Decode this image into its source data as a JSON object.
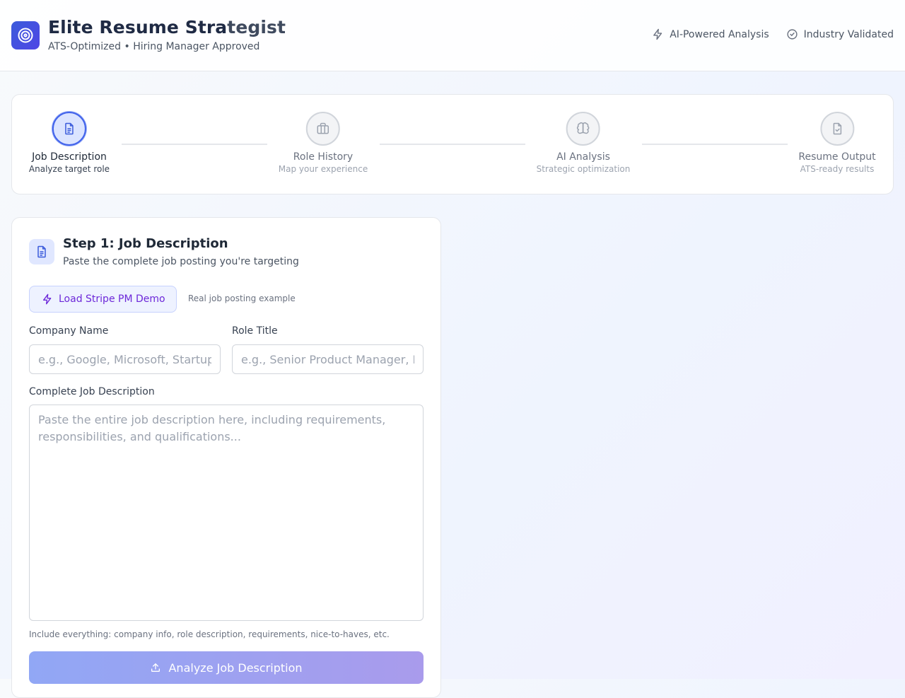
{
  "header": {
    "title_main": "Elite Resume Stra",
    "title_fade": "tegist",
    "subtitle": "ATS-Optimized • Hiring Manager Approved",
    "badges": [
      {
        "icon": "lightning-icon",
        "label": "AI-Powered Analysis"
      },
      {
        "icon": "check-circle-icon",
        "label": "Industry Validated"
      }
    ]
  },
  "steps": [
    {
      "title": "Job Description",
      "subtitle": "Analyze target role",
      "icon": "document-icon",
      "active": true
    },
    {
      "title": "Role History",
      "subtitle": "Map your experience",
      "icon": "briefcase-icon",
      "active": false
    },
    {
      "title": "AI Analysis",
      "subtitle": "Strategic optimization",
      "icon": "brain-icon",
      "active": false
    },
    {
      "title": "Resume Output",
      "subtitle": "ATS-ready results",
      "icon": "file-check-icon",
      "active": false
    }
  ],
  "form": {
    "title": "Step 1: Job Description",
    "description": "Paste the complete job posting you're targeting",
    "demo_button": "Load Stripe PM Demo",
    "demo_hint": "Real job posting example",
    "company_label": "Company Name",
    "company_placeholder": "e.g., Google, Microsoft, Startup",
    "company_value": "",
    "role_label": "Role Title",
    "role_placeholder": "e.g., Senior Product Manager, Engineer",
    "role_value": "",
    "jd_label": "Complete Job Description",
    "jd_placeholder": "Paste the entire job description here, including requirements, responsibilities, and qualifications...",
    "jd_value": "",
    "help_text": "Include everything: company info, role description, requirements, nice-to-haves, etc.",
    "submit_label": "Analyze Job Description"
  },
  "colors": {
    "accent": "#4263eb",
    "accent_light": "#dbe4ff",
    "demo_text": "#6d28d9",
    "button_gradient_start": "#91a7f5",
    "button_gradient_end": "#a99bec"
  }
}
